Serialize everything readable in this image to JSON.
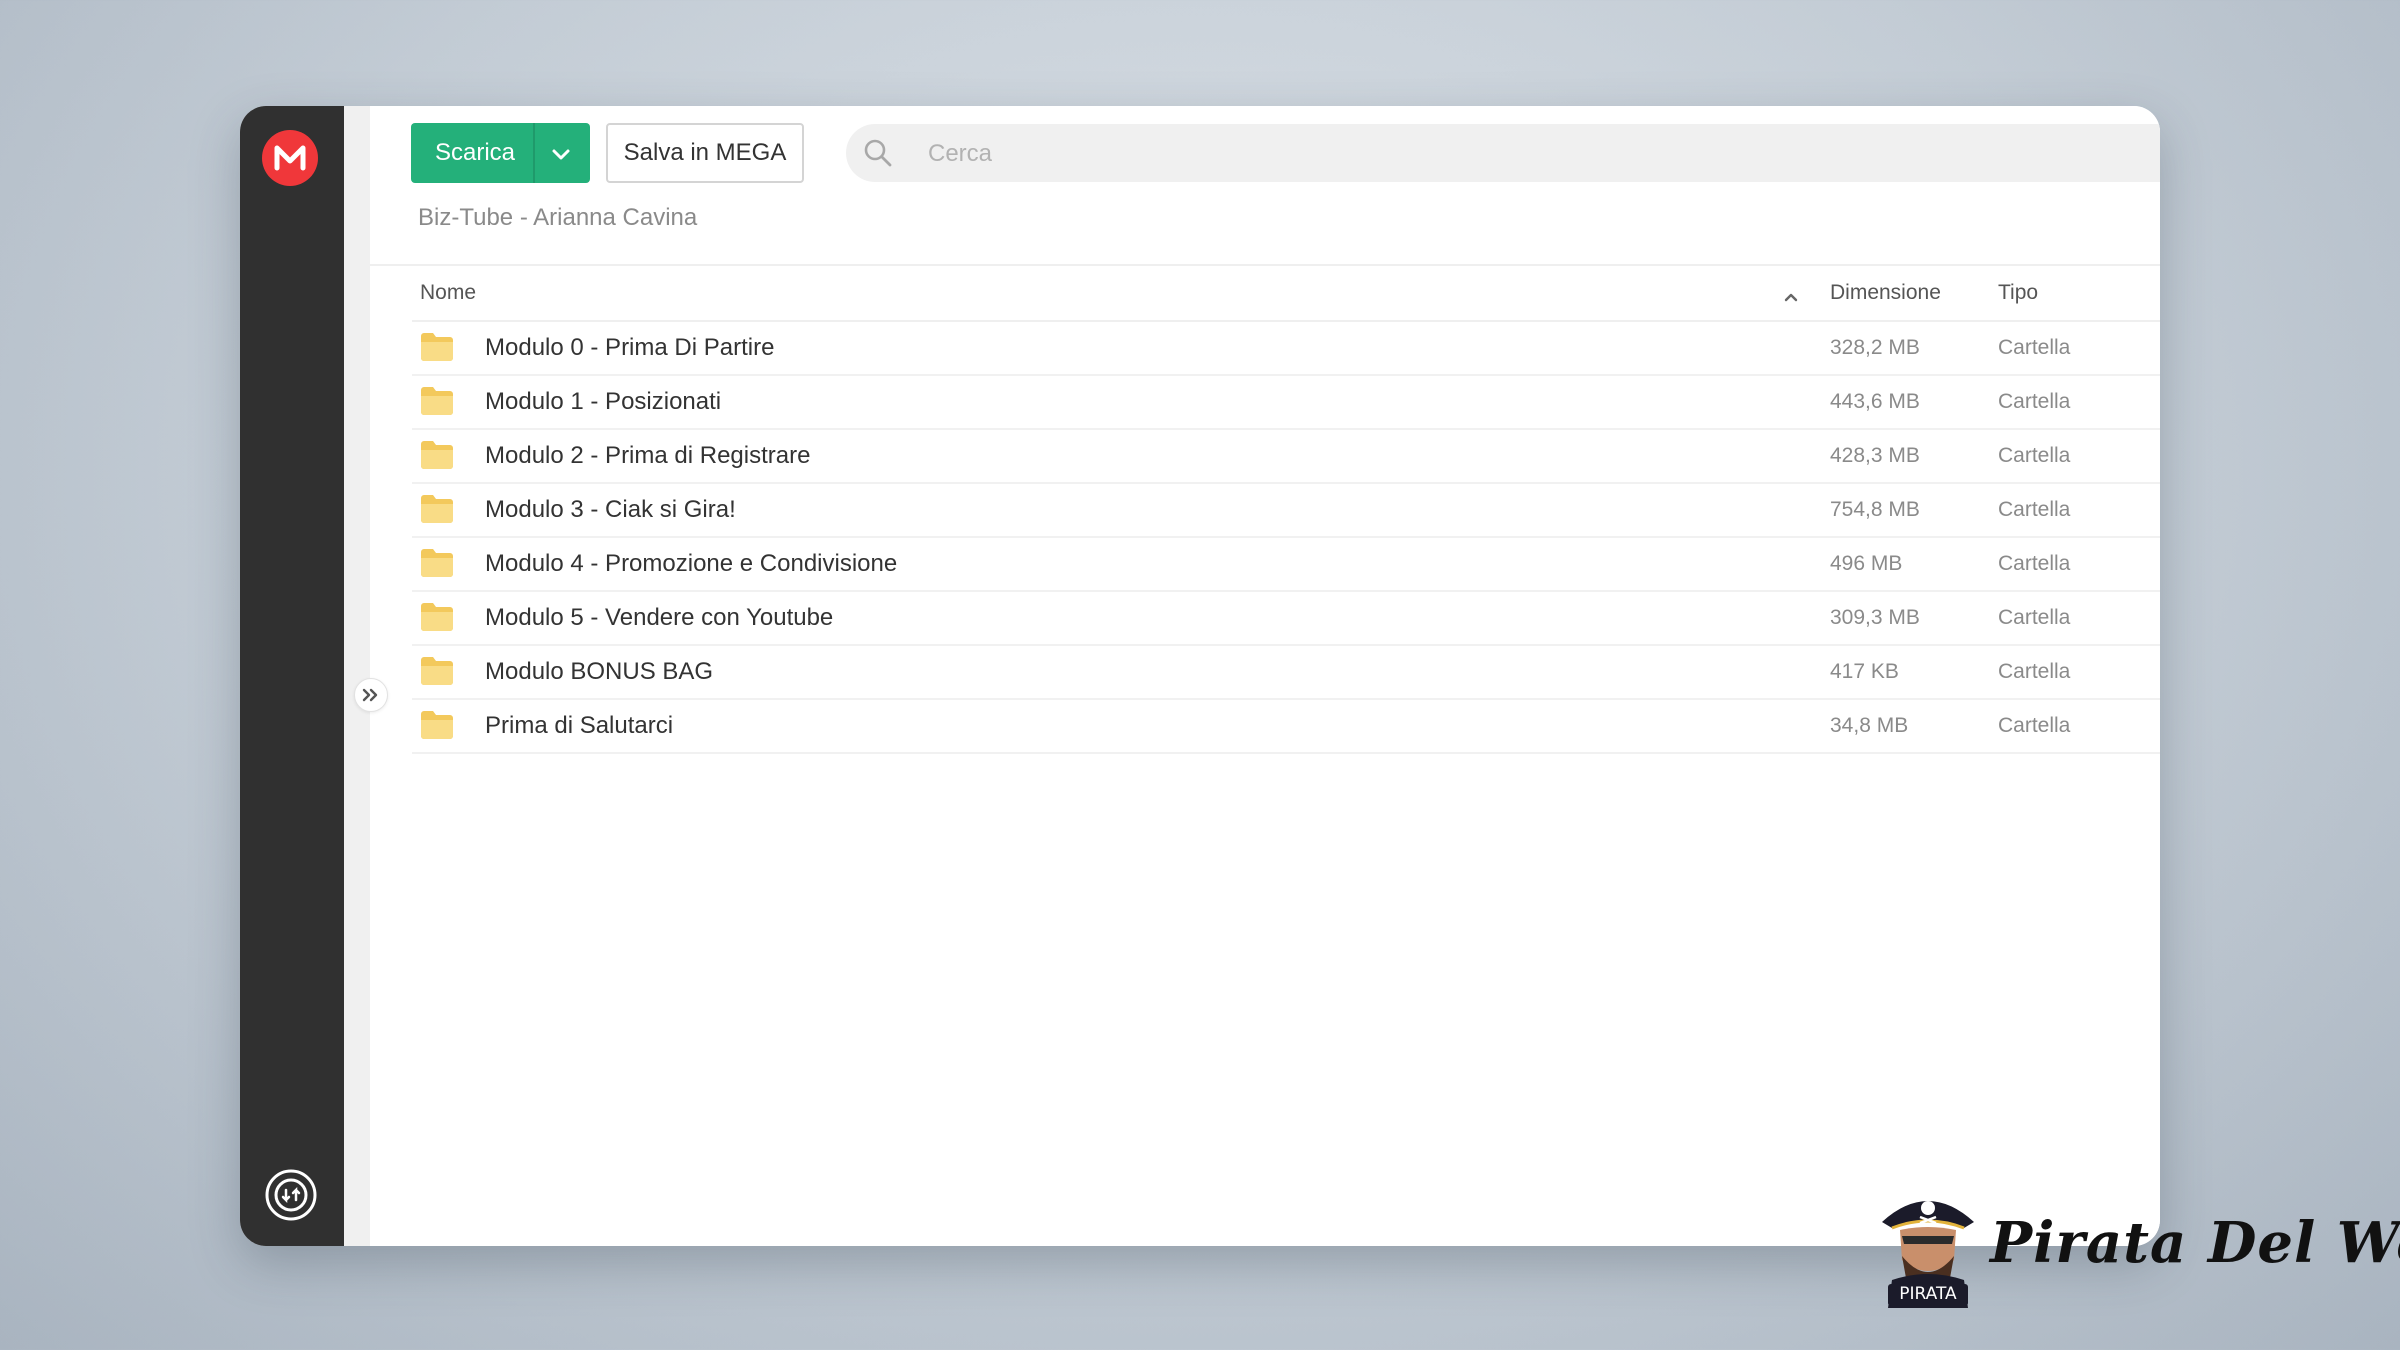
{
  "toolbar": {
    "download_label": "Scarica",
    "save_label": "Salva in MEGA",
    "search_placeholder": "Cerca"
  },
  "breadcrumb": "Biz-Tube - Arianna Cavina",
  "table": {
    "columns": {
      "name": "Nome",
      "size": "Dimensione",
      "type": "Tipo"
    },
    "sort": "name-ascending",
    "rows": [
      {
        "name": "Modulo 0 - Prima Di Partire",
        "size": "328,2 MB",
        "type": "Cartella"
      },
      {
        "name": "Modulo 1 - Posizionati",
        "size": "443,6 MB",
        "type": "Cartella"
      },
      {
        "name": "Modulo 2 - Prima di Registrare",
        "size": "428,3 MB",
        "type": "Cartella"
      },
      {
        "name": "Modulo 3 - Ciak si Gira!",
        "size": "754,8 MB",
        "type": "Cartella"
      },
      {
        "name": "Modulo 4 - Promozione e Condivisione",
        "size": "496 MB",
        "type": "Cartella"
      },
      {
        "name": "Modulo 5 - Vendere con Youtube",
        "size": "309,3 MB",
        "type": "Cartella"
      },
      {
        "name": "Modulo BONUS BAG",
        "size": "417 KB",
        "type": "Cartella"
      },
      {
        "name": "Prima di Salutarci",
        "size": "34,8 MB",
        "type": "Cartella"
      }
    ]
  },
  "watermark": {
    "text": "Pirata Del Web",
    "badge": "PIRATA"
  },
  "icons": {
    "logo": "mega-logo-icon",
    "sync": "sync-icon",
    "expand": "expand-sidebar-icon",
    "search": "search-icon",
    "folder": "folder-icon"
  },
  "colors": {
    "accent_green": "#24b07a",
    "brand_red": "#f0373a",
    "sidebar": "#303030",
    "folder": "#f7d77b"
  }
}
